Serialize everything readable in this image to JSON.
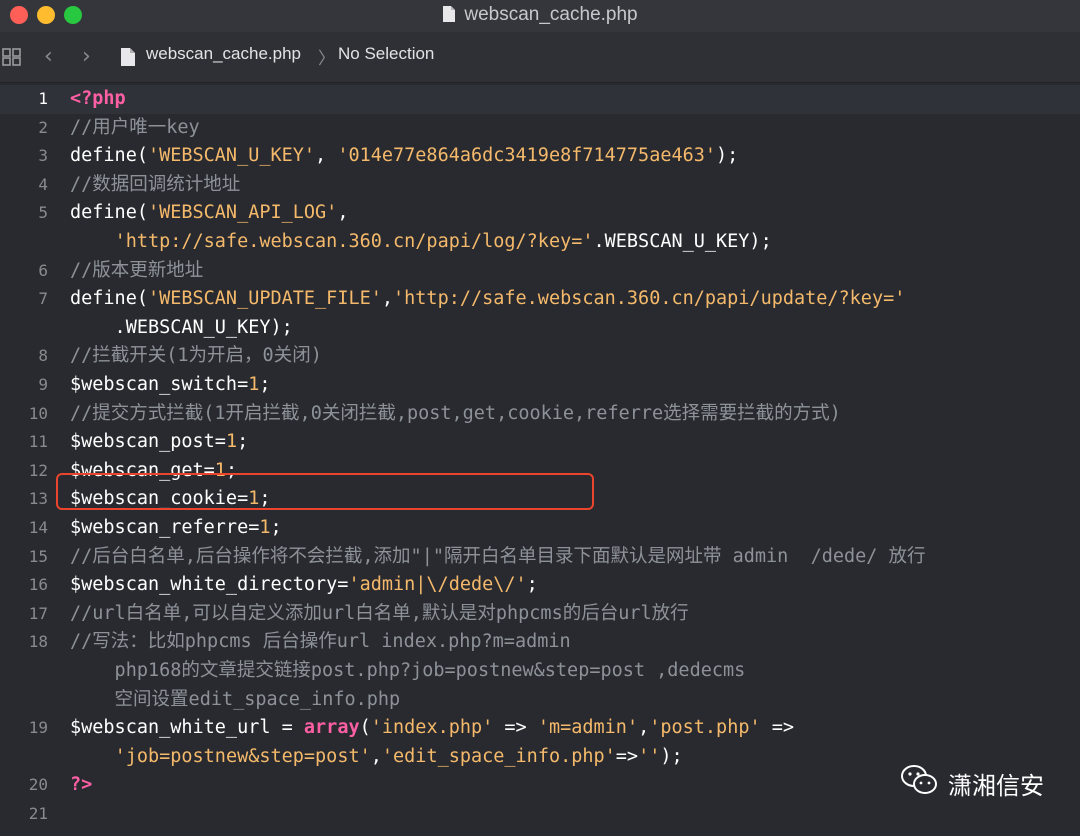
{
  "window": {
    "title": "webscan_cache.php",
    "traffic_lights": {
      "close": "#ff5f57",
      "minimize": "#febc2e",
      "zoom": "#28c840"
    }
  },
  "jumpbar": {
    "file": "webscan_cache.php",
    "separator": "〉",
    "selection": "No Selection"
  },
  "editor": {
    "lines": [
      {
        "number": "1",
        "tokens": [
          {
            "t": "<?php",
            "c": "kw"
          }
        ]
      },
      {
        "number": "2",
        "tokens": [
          {
            "t": "//用户唯一key",
            "c": "cm"
          }
        ]
      },
      {
        "number": "3",
        "tokens": [
          {
            "t": "define(",
            "c": "pl"
          },
          {
            "t": "'WEBSCAN_U_KEY'",
            "c": "strg"
          },
          {
            "t": ", ",
            "c": "pl"
          },
          {
            "t": "'014e77e864a6dc3419e8f714775ae463'",
            "c": "strg"
          },
          {
            "t": ");",
            "c": "pl"
          }
        ]
      },
      {
        "number": "4",
        "tokens": [
          {
            "t": "//数据回调统计地址",
            "c": "cm"
          }
        ]
      },
      {
        "number": "5",
        "tokens": [
          {
            "t": "define(",
            "c": "pl"
          },
          {
            "t": "'WEBSCAN_API_LOG'",
            "c": "strg"
          },
          {
            "t": ",",
            "c": "pl"
          }
        ]
      },
      {
        "number": "",
        "tokens": [
          {
            "t": "    ",
            "c": "pl"
          },
          {
            "t": "'http://safe.webscan.360.cn/papi/log/?key='",
            "c": "strg"
          },
          {
            "t": ".WEBSCAN_U_KEY);",
            "c": "pl"
          }
        ]
      },
      {
        "number": "6",
        "tokens": [
          {
            "t": "//版本更新地址",
            "c": "cm"
          }
        ]
      },
      {
        "number": "7",
        "tokens": [
          {
            "t": "define(",
            "c": "pl"
          },
          {
            "t": "'WEBSCAN_UPDATE_FILE'",
            "c": "strg"
          },
          {
            "t": ",",
            "c": "pl"
          },
          {
            "t": "'http://safe.webscan.360.cn/papi/update/?key='",
            "c": "strg"
          }
        ]
      },
      {
        "number": "",
        "tokens": [
          {
            "t": "    .WEBSCAN_U_KEY);",
            "c": "pl"
          }
        ]
      },
      {
        "number": "8",
        "tokens": [
          {
            "t": "//拦截开关(1为开启，0关闭)",
            "c": "cm"
          }
        ]
      },
      {
        "number": "9",
        "tokens": [
          {
            "t": "$webscan_switch=",
            "c": "pl"
          },
          {
            "t": "1",
            "c": "strg"
          },
          {
            "t": ";",
            "c": "pl"
          }
        ]
      },
      {
        "number": "10",
        "tokens": [
          {
            "t": "//提交方式拦截(1开启拦截,0关闭拦截,post,get,cookie,referre选择需要拦截的方式)",
            "c": "cm"
          }
        ]
      },
      {
        "number": "11",
        "tokens": [
          {
            "t": "$webscan_post=",
            "c": "pl"
          },
          {
            "t": "1",
            "c": "strg"
          },
          {
            "t": ";",
            "c": "pl"
          }
        ]
      },
      {
        "number": "12",
        "tokens": [
          {
            "t": "$webscan_get=",
            "c": "pl"
          },
          {
            "t": "1",
            "c": "strg"
          },
          {
            "t": ";",
            "c": "pl"
          }
        ]
      },
      {
        "number": "13",
        "tokens": [
          {
            "t": "$webscan_cookie=",
            "c": "pl"
          },
          {
            "t": "1",
            "c": "strg"
          },
          {
            "t": ";",
            "c": "pl"
          }
        ]
      },
      {
        "number": "14",
        "tokens": [
          {
            "t": "$webscan_referre=",
            "c": "pl"
          },
          {
            "t": "1",
            "c": "strg"
          },
          {
            "t": ";",
            "c": "pl"
          }
        ]
      },
      {
        "number": "15",
        "tokens": [
          {
            "t": "//后台白名单,后台操作将不会拦截,添加\"|\"隔开白名单目录下面默认是网址带 admin  /dede/ 放行",
            "c": "cm"
          }
        ]
      },
      {
        "number": "16",
        "tokens": [
          {
            "t": "$webscan_white_directory=",
            "c": "pl"
          },
          {
            "t": "'admin|\\/dede\\/'",
            "c": "strg"
          },
          {
            "t": ";",
            "c": "pl"
          }
        ]
      },
      {
        "number": "17",
        "tokens": [
          {
            "t": "//url白名单,可以自定义添加url白名单,默认是对phpcms的后台url放行",
            "c": "cm"
          }
        ]
      },
      {
        "number": "18",
        "tokens": [
          {
            "t": "//写法：比如phpcms 后台操作url index.php?m=admin",
            "c": "cm"
          }
        ]
      },
      {
        "number": "",
        "tokens": [
          {
            "t": "    php168的文章提交链接post.php?job=postnew&step=post ,dedecms",
            "c": "cm"
          }
        ]
      },
      {
        "number": "",
        "tokens": [
          {
            "t": "    空间设置edit_space_info.php",
            "c": "cm"
          }
        ]
      },
      {
        "number": "19",
        "tokens": [
          {
            "t": "$webscan_white_url = ",
            "c": "pl"
          },
          {
            "t": "array",
            "c": "kw"
          },
          {
            "t": "(",
            "c": "pl"
          },
          {
            "t": "'index.php'",
            "c": "strg"
          },
          {
            "t": " => ",
            "c": "pl"
          },
          {
            "t": "'m=admin'",
            "c": "strg"
          },
          {
            "t": ",",
            "c": "pl"
          },
          {
            "t": "'post.php'",
            "c": "strg"
          },
          {
            "t": " =>",
            "c": "pl"
          }
        ]
      },
      {
        "number": "",
        "tokens": [
          {
            "t": "    ",
            "c": "pl"
          },
          {
            "t": "'job=postnew&step=post'",
            "c": "strg"
          },
          {
            "t": ",",
            "c": "pl"
          },
          {
            "t": "'edit_space_info.php'",
            "c": "strg"
          },
          {
            "t": "=>",
            "c": "pl"
          },
          {
            "t": "''",
            "c": "strg"
          },
          {
            "t": ");",
            "c": "pl"
          }
        ]
      },
      {
        "number": "20",
        "tokens": [
          {
            "t": "?>",
            "c": "kw"
          }
        ]
      },
      {
        "number": "21",
        "tokens": []
      }
    ]
  },
  "watermark": {
    "text": "潇湘信安",
    "icon": "wechat-icon"
  }
}
